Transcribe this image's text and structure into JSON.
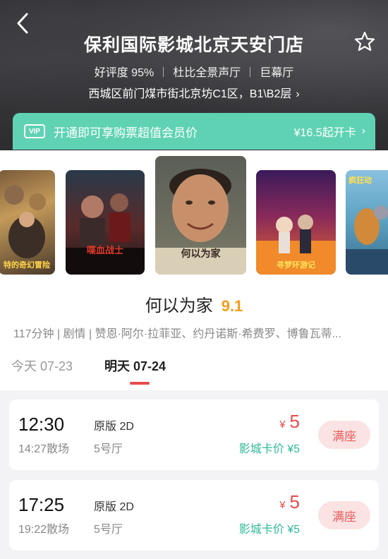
{
  "cinema": {
    "name": "保利国际影城北京天安门店",
    "tags": [
      "好评度 95%",
      "杜比全景声厅",
      "巨幕厅"
    ],
    "address": "西城区前门煤市街北京坊C1区，B1\\B2层"
  },
  "vip": {
    "badge": "VIP",
    "text": "开通即可享购票超值会员价",
    "price": "¥16.5起开卡"
  },
  "posters": [
    {
      "title": "特的奇幻冒险"
    },
    {
      "title": "喋血战士"
    },
    {
      "title": "何以为家"
    },
    {
      "title": "寻梦环游记"
    },
    {
      "title": "疯狂动"
    }
  ],
  "movie": {
    "title": "何以为家",
    "score": "9.1",
    "info": "117分钟 | 剧情 | 赞恩·阿尔·拉菲亚、约丹诺斯·希费罗、博鲁瓦蒂..."
  },
  "date_tabs": [
    {
      "label": "今天 07-23",
      "active": false
    },
    {
      "label": "明天 07-24",
      "active": true
    }
  ],
  "showtimes": [
    {
      "start": "12:30",
      "end": "14:27散场",
      "version": "原版 2D",
      "hall": "5号厅",
      "currency": "¥",
      "price": "5",
      "card_price": "影城卡价 ¥5",
      "status": "满座"
    },
    {
      "start": "17:25",
      "end": "19:22散场",
      "version": "原版 2D",
      "hall": "5号厅",
      "currency": "¥",
      "price": "5",
      "card_price": "影城卡价 ¥5",
      "status": "满座"
    }
  ],
  "colors": {
    "accent_red": "#e74c4c",
    "vip_green": "#5fd2b4",
    "score_orange": "#f29d1e",
    "card_price_green": "#2fb89a"
  }
}
